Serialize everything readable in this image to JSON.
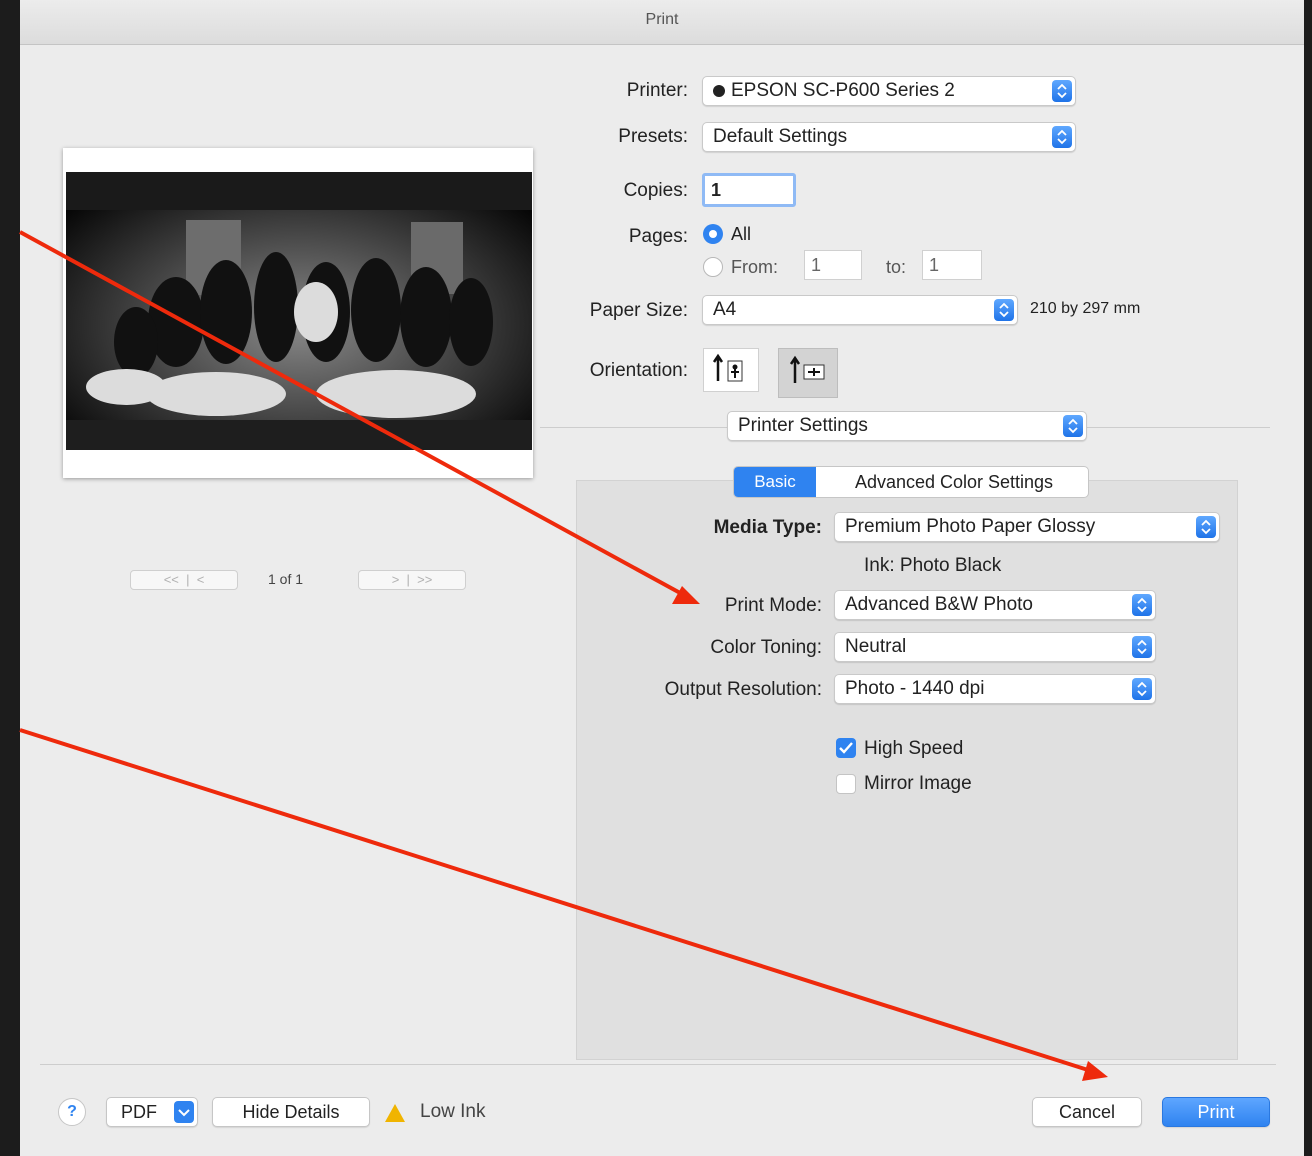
{
  "window": {
    "title": "Print"
  },
  "printer": {
    "label": "Printer:",
    "value": "EPSON SC-P600 Series 2"
  },
  "presets": {
    "label": "Presets:",
    "value": "Default Settings"
  },
  "copies": {
    "label": "Copies:",
    "value": "1"
  },
  "pages": {
    "label": "Pages:",
    "all_label": "All",
    "from_label": "From:",
    "from_value": "1",
    "to_label": "to:",
    "to_value": "1"
  },
  "paper_size": {
    "label": "Paper Size:",
    "value": "A4",
    "dimensions": "210 by 297 mm"
  },
  "orientation": {
    "label": "Orientation:"
  },
  "preview": {
    "page_indicator": "1 of 1",
    "first": "<<",
    "prev": "<",
    "next": ">",
    "last": ">>"
  },
  "section_popup": {
    "value": "Printer Settings"
  },
  "tabs": {
    "basic": "Basic",
    "advanced": "Advanced Color Settings"
  },
  "media_type": {
    "label": "Media Type:",
    "value": "Premium Photo Paper Glossy"
  },
  "ink": {
    "text": "Ink: Photo Black"
  },
  "print_mode": {
    "label": "Print Mode:",
    "value": "Advanced B&W Photo"
  },
  "color_toning": {
    "label": "Color Toning:",
    "value": "Neutral"
  },
  "output_resolution": {
    "label": "Output Resolution:",
    "value": "Photo - 1440 dpi"
  },
  "high_speed": {
    "label": "High Speed",
    "checked": true
  },
  "mirror_image": {
    "label": "Mirror Image",
    "checked": false
  },
  "footer": {
    "help": "?",
    "pdf": "PDF",
    "hide_details": "Hide Details",
    "warning": "Low Ink",
    "cancel": "Cancel",
    "print": "Print"
  },
  "colors": {
    "accent": "#2f83f0",
    "arrow": "#ee2a0c",
    "warning": "#f0b400"
  }
}
